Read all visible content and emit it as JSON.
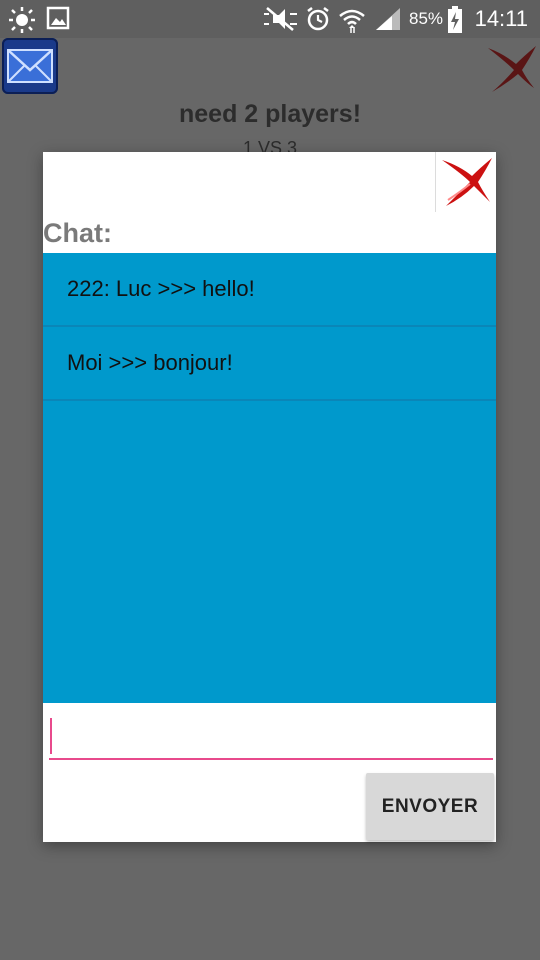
{
  "status_bar": {
    "battery_percent": "85%",
    "time": "14:11",
    "icons": [
      "brightness-icon",
      "image-icon",
      "mute-icon",
      "alarm-icon",
      "wifi-icon",
      "signal-icon",
      "battery-charging-icon"
    ]
  },
  "background_app": {
    "title": "need 2 players!",
    "subtitle": "1 VS 3",
    "icons": [
      "mail-icon",
      "close-icon"
    ]
  },
  "chat_dialog": {
    "title": "Chat:",
    "messages": [
      {
        "text": "222: Luc >>> hello!"
      },
      {
        "text": "Moi >>> bonjour!"
      }
    ],
    "input_value": "",
    "input_placeholder": "",
    "send_label": "ENVOYER",
    "colors": {
      "list_background": "#0099cc",
      "input_accent": "#e84a8c",
      "close_icon": "#cc1111"
    }
  }
}
